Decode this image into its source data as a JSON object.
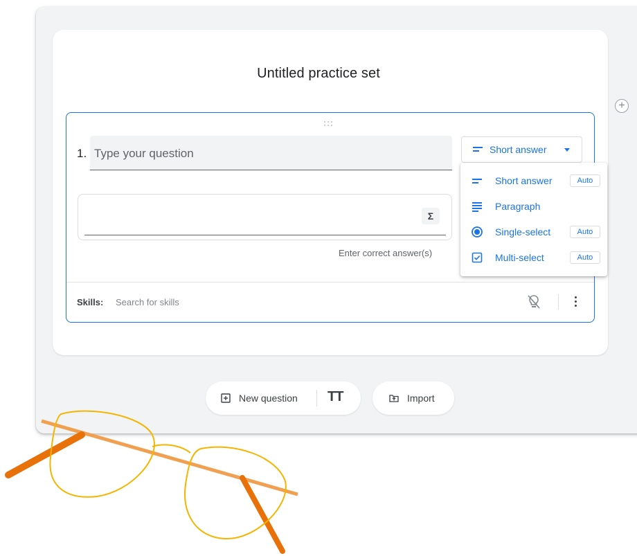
{
  "form": {
    "title": "Untitled practice set"
  },
  "question": {
    "number": "1.",
    "placeholder": "Type your question",
    "type_label": "Short answer",
    "answer_hint": "Enter correct answer(s)",
    "sigma": "Σ",
    "skills_label": "Skills:",
    "skills_placeholder": "Search for skills"
  },
  "type_menu": {
    "options": [
      {
        "label": "Short answer",
        "icon": "short-answer-icon",
        "badge": "Auto"
      },
      {
        "label": "Paragraph",
        "icon": "paragraph-icon",
        "badge": ""
      },
      {
        "label": "Single-select",
        "icon": "radio-icon",
        "badge": "Auto"
      },
      {
        "label": "Multi-select",
        "icon": "checkbox-icon",
        "badge": "Auto"
      }
    ]
  },
  "toolbar": {
    "new_question": "New question",
    "import": "Import",
    "text_icon": "TT"
  },
  "colors": {
    "accent": "#1a73e8",
    "background": "#f1f3f4",
    "glasses_frame": "#f4b400",
    "glasses_arm": "#e8710a"
  }
}
